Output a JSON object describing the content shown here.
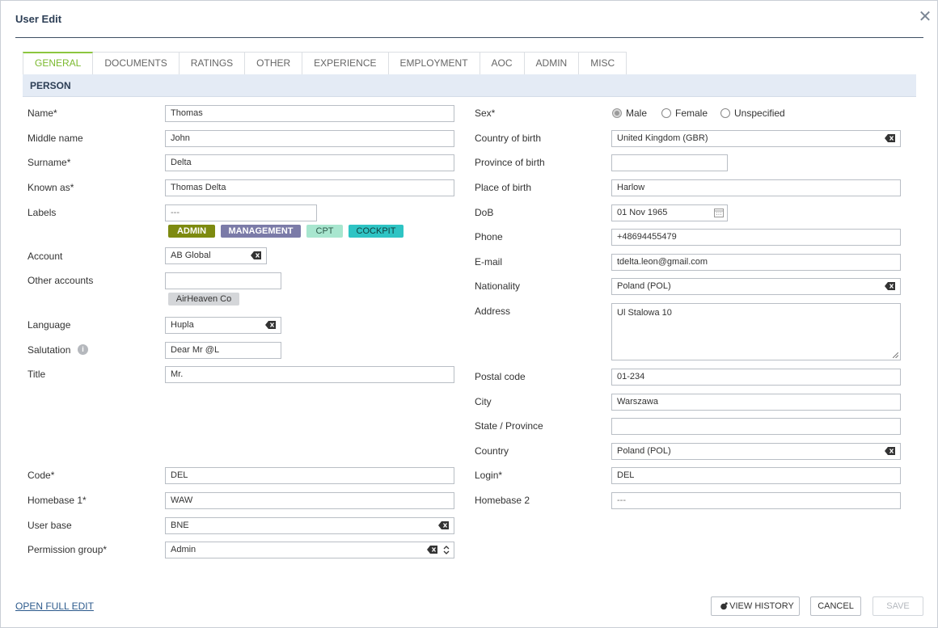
{
  "dialog": {
    "title": "User Edit",
    "close_icon": "close-icon"
  },
  "tabs": [
    "GENERAL",
    "DOCUMENTS",
    "RATINGS",
    "OTHER",
    "EXPERIENCE",
    "EMPLOYMENT",
    "AOC",
    "ADMIN",
    "MISC"
  ],
  "section": "PERSON",
  "left": {
    "name": {
      "label": "Name*",
      "value": "Thomas"
    },
    "middle_name": {
      "label": "Middle name",
      "value": "John"
    },
    "surname": {
      "label": "Surname*",
      "value": "Delta"
    },
    "known_as": {
      "label": "Known as*",
      "value": "Thomas Delta"
    },
    "labels": {
      "label": "Labels",
      "value": "---",
      "tags": [
        {
          "text": "ADMIN",
          "color": "#7d8a10"
        },
        {
          "text": "MANAGEMENT",
          "color": "#7b7ba8"
        },
        {
          "text": "CPT",
          "color": "#a8e6cf"
        },
        {
          "text": "COCKPIT",
          "color": "#2ec4c4"
        }
      ]
    },
    "account": {
      "label": "Account",
      "value": "AB Global"
    },
    "other_accounts": {
      "label": "Other accounts",
      "value": "",
      "chip": "AirHeaven Co"
    },
    "language": {
      "label": "Language",
      "value": "Hupla"
    },
    "salutation": {
      "label": "Salutation",
      "value": "Dear Mr @L"
    },
    "title": {
      "label": "Title",
      "value": "Mr."
    },
    "code": {
      "label": "Code*",
      "value": "DEL"
    },
    "homebase1": {
      "label": "Homebase 1*",
      "value": "WAW"
    },
    "user_base": {
      "label": "User base",
      "value": "BNE"
    },
    "permission_group": {
      "label": "Permission group*",
      "value": "Admin"
    }
  },
  "right": {
    "sex": {
      "label": "Sex*",
      "options": [
        "Male",
        "Female",
        "Unspecified"
      ],
      "selected": "Male"
    },
    "country_of_birth": {
      "label": "Country of birth",
      "value": "United Kingdom (GBR)"
    },
    "province_of_birth": {
      "label": "Province of birth",
      "value": ""
    },
    "place_of_birth": {
      "label": "Place of birth",
      "value": "Harlow"
    },
    "dob": {
      "label": "DoB",
      "value": "01 Nov 1965"
    },
    "phone": {
      "label": "Phone",
      "value": "+48694455479"
    },
    "email": {
      "label": "E-mail",
      "value": "tdelta.leon@gmail.com"
    },
    "nationality": {
      "label": "Nationality",
      "value": "Poland (POL)"
    },
    "address": {
      "label": "Address",
      "value": "Ul Stalowa 10"
    },
    "postal_code": {
      "label": "Postal code",
      "value": "01-234"
    },
    "city": {
      "label": "City",
      "value": "Warszawa"
    },
    "state": {
      "label": "State / Province",
      "value": ""
    },
    "country": {
      "label": "Country",
      "value": "Poland (POL)"
    },
    "login": {
      "label": "Login*",
      "value": "DEL"
    },
    "homebase2": {
      "label": "Homebase 2",
      "value": "---"
    }
  },
  "footer": {
    "open_full_edit": "OPEN FULL EDIT",
    "view_history": "VIEW HISTORY",
    "cancel": "CANCEL",
    "save": "SAVE"
  },
  "colors": {
    "accent": "#8cc63f",
    "section_bg": "#e4ebf5",
    "title": "#2c3e55"
  }
}
